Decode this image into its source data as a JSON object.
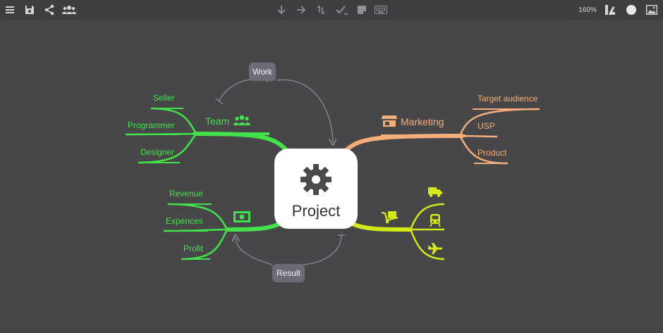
{
  "toolbar": {
    "left": [
      {
        "name": "menu-icon"
      },
      {
        "name": "save-icon"
      },
      {
        "name": "share-icon"
      },
      {
        "name": "users-icon"
      }
    ],
    "center": [
      {
        "name": "arrow-down-icon"
      },
      {
        "name": "arrow-right-icon"
      },
      {
        "name": "swap-icon"
      },
      {
        "name": "check-icon"
      },
      {
        "name": "note-icon"
      },
      {
        "name": "keyboard-icon"
      }
    ],
    "zoom": "160%",
    "right": [
      {
        "name": "style-icon"
      },
      {
        "name": "color-circle-icon"
      },
      {
        "name": "image-icon"
      }
    ]
  },
  "colors": {
    "background": "#474649",
    "toolbar": "#3f3e41",
    "green": "#44e24a",
    "orange": "#f5ae79",
    "yellow": "#d4e818",
    "relation": "#6e6a77"
  },
  "root": {
    "title": "Project",
    "icon": "gear-icon"
  },
  "branches": {
    "team": {
      "label": "Team",
      "icon": "users-icon",
      "children": [
        "Seller",
        "Programmer",
        "Designer"
      ]
    },
    "marketing": {
      "label": "Marketing",
      "icon": "store-icon",
      "children": [
        "Target audience",
        "USP",
        "Product"
      ]
    },
    "finance": {
      "icon": "money-icon",
      "children": [
        "Revenue",
        "Expences",
        "Profit"
      ]
    },
    "logistics": {
      "icon": "dolly-icon",
      "children": [
        {
          "icon": "truck-icon"
        },
        {
          "icon": "train-icon"
        },
        {
          "icon": "plane-icon"
        }
      ]
    }
  },
  "relations": {
    "work": "Work",
    "result": "Result"
  }
}
